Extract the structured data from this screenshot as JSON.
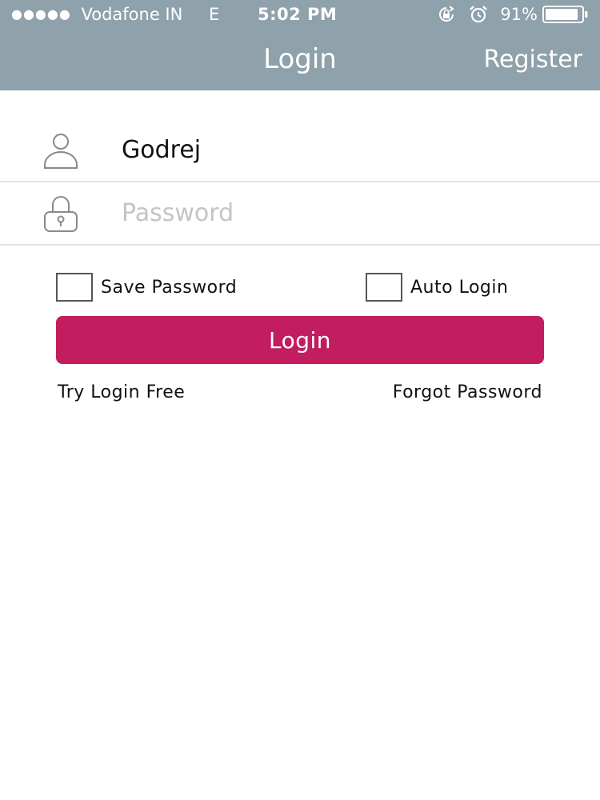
{
  "status_bar": {
    "signal": "●●●●●",
    "carrier": "Vodafone IN",
    "network": "E",
    "time": "5:02 PM",
    "battery_percent": "91%",
    "battery_level": 0.91
  },
  "nav": {
    "title": "Login",
    "register_label": "Register"
  },
  "form": {
    "username": {
      "value": "Godrej",
      "icon": "user-icon"
    },
    "password": {
      "value": "",
      "placeholder": "Password",
      "icon": "lock-icon"
    },
    "save_password_label": "Save Password",
    "save_password_checked": false,
    "auto_login_label": "Auto Login",
    "auto_login_checked": false,
    "login_button_label": "Login",
    "try_login_free_label": "Try Login Free",
    "forgot_password_label": "Forgot Password"
  },
  "colors": {
    "header_bg": "#8fa1aa",
    "accent": "#c21d5e",
    "divider": "#e3e3e3",
    "placeholder": "#c4c4c8"
  }
}
